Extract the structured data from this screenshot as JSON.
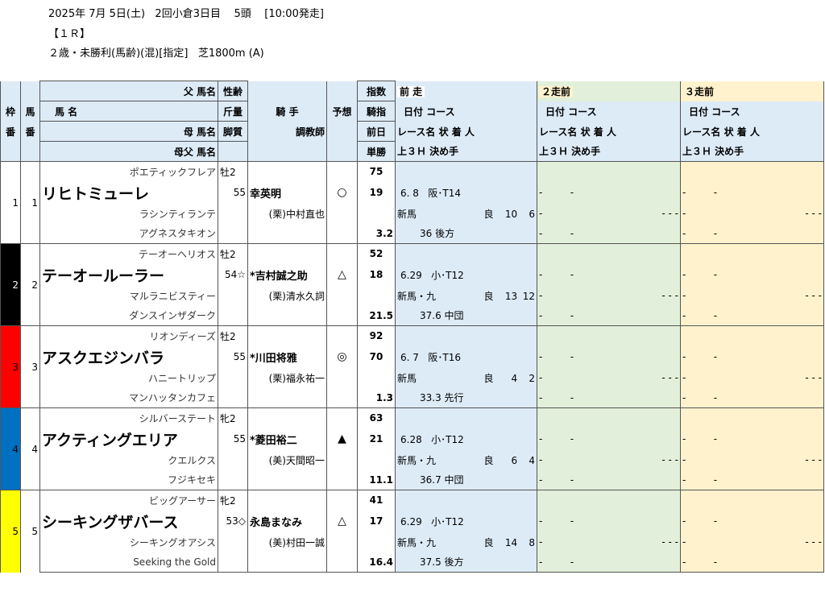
{
  "header": {
    "line1": "2025年 7月 5日(土)   2回小倉3日目    5頭    [10:00発走]",
    "line2": "【１Ｒ】",
    "line3": "２歳・未勝利(馬齢)(混)[指定]   芝1800m (A)"
  },
  "columns": {
    "waku": "枠",
    "waku2": "番",
    "uma": "馬",
    "uma2": "番",
    "father": "父  馬名",
    "name": "馬      名",
    "mother": "母  馬名",
    "broodsire": "母父  馬名",
    "sex_age": "性齢",
    "weight": "斤量",
    "style": "脚質",
    "jockey": "騎  手",
    "trainer": "調教師",
    "pred": "予想",
    "idx1": "指数",
    "idx2": "騎指",
    "idx3": "前日",
    "idx4": "単勝",
    "prev1_title": "前  走",
    "prev2_title": "２走前",
    "prev3_title": "３走前",
    "date_course": "日付   コース",
    "race_result": "レース名          状 着 人",
    "last3f": "上３Ｈ  決め手"
  },
  "horses": [
    {
      "waku": "1",
      "waku_color": "#ffffff",
      "waku_text": "#000000",
      "num": "1",
      "father": "ポエティックフレア",
      "name": "リヒトミューレ",
      "mother": "ラシンティランテ",
      "broodsire": "アグネスタキオン",
      "sex_age": "牡2",
      "weight": "55",
      "jockey": "幸英明",
      "trainer": "(栗)中村直也",
      "pred": "○",
      "idx": "75",
      "jidx": "19",
      "odds": "3.2",
      "p1_date": "6. 8",
      "p1_course": "阪･T14",
      "p1_race": "新馬",
      "p1_cond": "良",
      "p1_pos": "10",
      "p1_pop": "6",
      "p1_3f": "36",
      "p1_style": "後方"
    },
    {
      "waku": "2",
      "waku_color": "#000000",
      "waku_text": "#ffffff",
      "num": "2",
      "father": "テーオーヘリオス",
      "name": "テーオールーラー",
      "mother": "マルラニビスティー",
      "broodsire": "ダンスインザダーク",
      "sex_age": "牡2",
      "weight": "54☆",
      "jockey": "*吉村誠之助",
      "trainer": "(栗)清水久詞",
      "pred": "△",
      "idx": "52",
      "jidx": "18",
      "odds": "21.5",
      "p1_date": "6.29",
      "p1_course": "小･T12",
      "p1_race": "新馬・九",
      "p1_cond": "良",
      "p1_pos": "13",
      "p1_pop": "12",
      "p1_3f": "37.6",
      "p1_style": "中団"
    },
    {
      "waku": "3",
      "waku_color": "#ff0000",
      "waku_text": "#000000",
      "num": "3",
      "father": "リオンディーズ",
      "name": "アスクエジンバラ",
      "mother": "ハニートリップ",
      "broodsire": "マンハッタンカフェ",
      "sex_age": "牡2",
      "weight": "55",
      "jockey": "*川田将雅",
      "trainer": "(栗)福永祐一",
      "pred": "◎",
      "idx": "92",
      "jidx": "70",
      "odds": "1.3",
      "p1_date": "6. 7",
      "p1_course": "阪･T16",
      "p1_race": "新馬",
      "p1_cond": "良",
      "p1_pos": "4",
      "p1_pop": "2",
      "p1_3f": "33.3",
      "p1_style": "先行"
    },
    {
      "waku": "4",
      "waku_color": "#0070c0",
      "waku_text": "#000000",
      "num": "4",
      "father": "シルバーステート",
      "name": "アクティングエリア",
      "mother": "クエルクス",
      "broodsire": "フジキセキ",
      "sex_age": "牝2",
      "weight": "55",
      "jockey": "*菱田裕二",
      "trainer": "(美)天間昭一",
      "pred": "▲",
      "idx": "63",
      "jidx": "21",
      "odds": "11.1",
      "p1_date": "6.28",
      "p1_course": "小･T12",
      "p1_race": "新馬・九",
      "p1_cond": "良",
      "p1_pos": "6",
      "p1_pop": "4",
      "p1_3f": "36.7",
      "p1_style": "中団"
    },
    {
      "waku": "5",
      "waku_color": "#ffff00",
      "waku_text": "#000000",
      "num": "5",
      "father": "ビッグアーサー",
      "name": "シーキングザバース",
      "mother": "シーキングオアシス",
      "broodsire": "Seeking the Gold",
      "sex_age": "牝2",
      "weight": "53◇",
      "jockey": "永島まなみ",
      "trainer": "(美)村田一誠",
      "pred": "△",
      "idx": "41",
      "jidx": "17",
      "odds": "16.4",
      "p1_date": "6.29",
      "p1_course": "小･T12",
      "p1_race": "新馬・九",
      "p1_cond": "良",
      "p1_pos": "14",
      "p1_pop": "8",
      "p1_3f": "37.5",
      "p1_style": "後方"
    }
  ],
  "empty": {
    "dash": "-",
    "dashes2": "- -",
    "dashes3": "-   -   -"
  }
}
